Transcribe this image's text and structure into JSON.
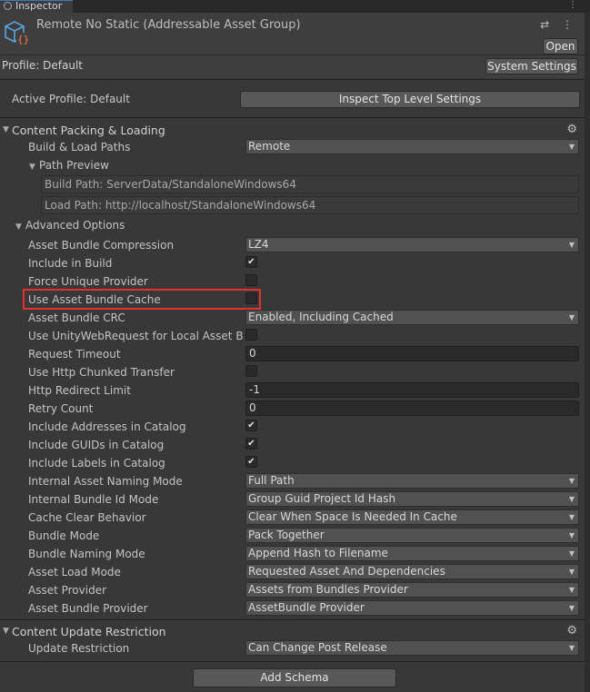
{
  "window": {
    "tab_label": "Inspector",
    "tab_actions": "⋮"
  },
  "header": {
    "title": "Remote No Static (Addressable Asset Group)",
    "open_label": "Open",
    "header_actions": "⇄ ⋮"
  },
  "profile": {
    "label": "Profile: Default",
    "system_settings_label": "System Settings",
    "active_label": "Active Profile: Default",
    "inspect_label": "Inspect Top Level Settings"
  },
  "content_packing": {
    "title": "Content Packing & Loading",
    "build_load_paths_label": "Build & Load Paths",
    "build_load_paths_value": "Remote",
    "path_preview_label": "Path Preview",
    "build_path": "Build Path: ServerData/StandaloneWindows64",
    "load_path": "Load Path: http://localhost/StandaloneWindows64",
    "advanced_label": "Advanced Options"
  },
  "advanced": [
    {
      "label": "Asset Bundle Compression",
      "type": "dropdown",
      "value": "LZ4"
    },
    {
      "label": "Include in Build",
      "type": "checkbox",
      "value": "✔"
    },
    {
      "label": "Force Unique Provider",
      "type": "checkbox",
      "value": ""
    },
    {
      "label": "Use Asset Bundle Cache",
      "type": "checkbox",
      "value": ""
    },
    {
      "label": "Asset Bundle CRC",
      "type": "dropdown",
      "value": "Enabled, Including Cached"
    },
    {
      "label": "Use UnityWebRequest for Local Asset Bundles",
      "type": "checkbox",
      "value": ""
    },
    {
      "label": "Request Timeout",
      "type": "text",
      "value": "0"
    },
    {
      "label": "Use Http Chunked Transfer",
      "type": "checkbox",
      "value": ""
    },
    {
      "label": "Http Redirect Limit",
      "type": "text",
      "value": "-1"
    },
    {
      "label": "Retry Count",
      "type": "text",
      "value": "0"
    },
    {
      "label": "Include Addresses in Catalog",
      "type": "checkbox",
      "value": "✔"
    },
    {
      "label": "Include GUIDs in Catalog",
      "type": "checkbox",
      "value": "✔"
    },
    {
      "label": "Include Labels in Catalog",
      "type": "checkbox",
      "value": "✔"
    },
    {
      "label": "Internal Asset Naming Mode",
      "type": "dropdown",
      "value": "Full Path"
    },
    {
      "label": "Internal Bundle Id Mode",
      "type": "dropdown",
      "value": "Group Guid Project Id Hash"
    },
    {
      "label": "Cache Clear Behavior",
      "type": "dropdown",
      "value": "Clear When Space Is Needed In Cache"
    },
    {
      "label": "Bundle Mode",
      "type": "dropdown",
      "value": "Pack Together"
    },
    {
      "label": "Bundle Naming Mode",
      "type": "dropdown",
      "value": "Append Hash to Filename"
    },
    {
      "label": "Asset Load Mode",
      "type": "dropdown",
      "value": "Requested Asset And Dependencies"
    },
    {
      "label": "Asset Provider",
      "type": "dropdown",
      "value": "Assets from Bundles Provider"
    },
    {
      "label": "Asset Bundle Provider",
      "type": "dropdown",
      "value": "AssetBundle Provider"
    }
  ],
  "content_update": {
    "title": "Content Update Restriction",
    "update_restriction_label": "Update Restriction",
    "update_restriction_value": "Can Change Post Release"
  },
  "add_schema_label": "Add Schema",
  "icons": {
    "section_foldout": "▼",
    "gear": "⚙",
    "dropdown_arrow": "▼"
  },
  "colors": {
    "background": "#383838",
    "highlight_box": "#e3312f",
    "tab_accent": "#3a79bb"
  }
}
